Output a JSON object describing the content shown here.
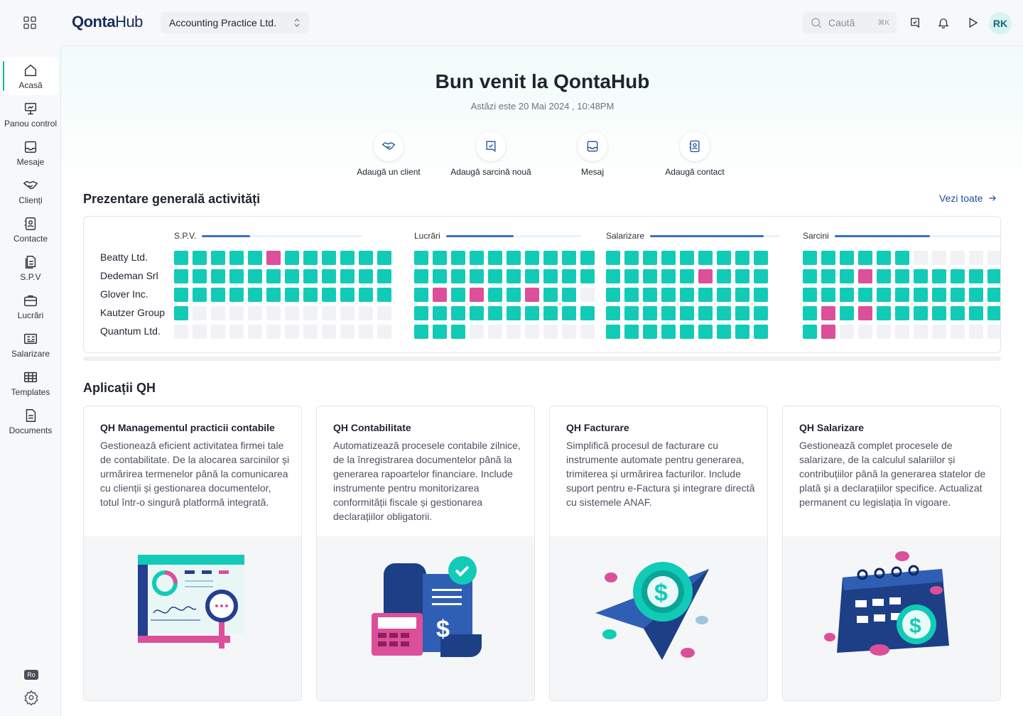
{
  "brand": {
    "logo_main": "Qonta",
    "logo_hub": "Hub"
  },
  "org": {
    "name": "Accounting Practice Ltd."
  },
  "search": {
    "placeholder": "Caută",
    "shortcut": "⌘K"
  },
  "user": {
    "initials": "RK"
  },
  "sidebar": {
    "items": [
      {
        "label": "Acasă",
        "icon": "home-icon"
      },
      {
        "label": "Panou control",
        "icon": "dashboard-icon"
      },
      {
        "label": "Mesaje",
        "icon": "inbox-icon"
      },
      {
        "label": "Clienți",
        "icon": "handshake-icon"
      },
      {
        "label": "Contacte",
        "icon": "contacts-icon"
      },
      {
        "label": "S.P.V",
        "icon": "documents-icon"
      },
      {
        "label": "Lucrări",
        "icon": "briefcase-icon"
      },
      {
        "label": "Salarizare",
        "icon": "payroll-icon"
      },
      {
        "label": "Templates",
        "icon": "templates-icon"
      },
      {
        "label": "Documents",
        "icon": "document-icon"
      }
    ],
    "language": "Ro"
  },
  "hero": {
    "title": "Bun venit la QontaHub",
    "date": "Astăzi este 20 Mai 2024 , 10:48PM"
  },
  "quick_actions": [
    {
      "label": "Adaugă un client",
      "icon": "handshake-icon"
    },
    {
      "label": "Adaugă sarcină nouă",
      "icon": "task-icon"
    },
    {
      "label": "Mesaj",
      "icon": "inbox-icon"
    },
    {
      "label": "Adaugă contact",
      "icon": "contact-icon"
    }
  ],
  "activity": {
    "title": "Prezentare generală activități",
    "see_all": "Vezi toate",
    "clients": [
      "Beatty Ltd.",
      "Dedeman Srl",
      "Glover Inc.",
      "Kautzer Group",
      "Quantum Ltd."
    ],
    "groups": [
      {
        "name": "S.P.V.",
        "progress": 0.3,
        "rows": [
          "gggggpgggggg",
          "gggggggggggg",
          "gggggggggggg",
          "geeeeeeeeeee",
          "eeeeeeeeeeee"
        ]
      },
      {
        "name": "Lucrări",
        "progress": 0.5,
        "rows": [
          "gggggggggg",
          "gggggggggg",
          "gpgpggpgge",
          "gggggggggg",
          "gggeeeeeee"
        ]
      },
      {
        "name": "Salarizare",
        "progress": 0.88,
        "rows": [
          "ggggggggg",
          "gggggpggg",
          "ggggggggg",
          "ggggggggg",
          "ggggggggg"
        ]
      },
      {
        "name": "Sarcini",
        "progress": 0.56,
        "rows": [
          "ggggggeeeeeeee",
          "gggpgggggggggg",
          "gggggggggggggg",
          "gpgpgggggggggg",
          "gpeeeeeeeeeeee"
        ]
      }
    ]
  },
  "apps": {
    "title": "Aplicații QH",
    "cards": [
      {
        "title": "QH Managementul practicii contabile",
        "description": "Gestionează eficient activitatea firmei tale de contabilitate. De la alocarea sarcinilor și urmărirea termenelor până la comunicarea cu clienții și gestionarea documentelor, totul într-o singură platformă integrată.",
        "illustration": "analytics-illustration"
      },
      {
        "title": "QH  Contabilitate",
        "description": "Automatizează procesele contabile zilnice, de la înregistrarea documentelor până la generarea rapoartelor financiare. Include instrumente pentru monitorizarea conformității fiscale și gestionarea declarațiilor obligatorii.",
        "illustration": "accounting-illustration"
      },
      {
        "title": "QH  Facturare",
        "description": "Simplifică procesul de facturare cu instrumente automate pentru generarea, trimiterea și urmărirea facturilor. Include suport pentru e-Factura și integrare directă cu sistemele ANAF.",
        "illustration": "invoicing-illustration"
      },
      {
        "title": "QH  Salarizare",
        "description": "Gestionează complet procesele de salarizare, de la calculul salariilor și contribuțiilor până la generarea statelor de plată și a declarațiilor specifice. Actualizat permanent cu legislația în vigoare.",
        "illustration": "payroll-illustration"
      }
    ]
  },
  "colors": {
    "accent": "#11cbb7",
    "alert": "#dc4f9a",
    "brand": "#1a2c57",
    "link": "#1d4f9c"
  }
}
